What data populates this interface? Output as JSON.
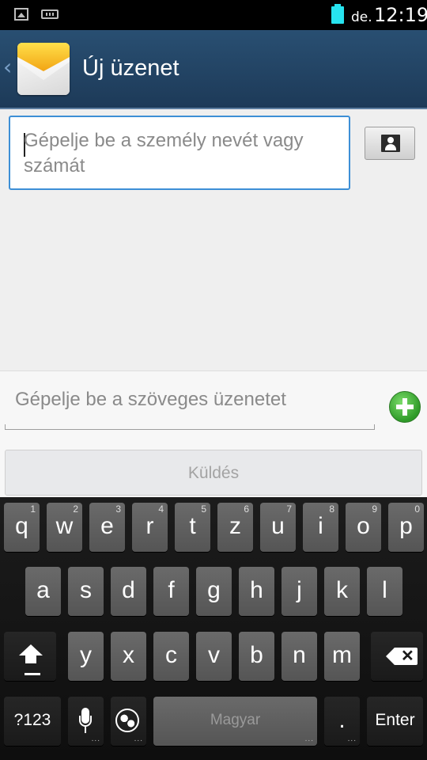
{
  "status_bar": {
    "icons": [
      "gallery-icon",
      "keyboard-icon",
      "battery-icon"
    ],
    "battery_color": "#27e3ef",
    "ampm": "de.",
    "time": "12:19"
  },
  "action_bar": {
    "back_glyph": "‹",
    "app_icon": "envelope-icon",
    "title": "Új üzenet",
    "background": "#244766"
  },
  "recipient": {
    "placeholder": "Gépelje be a személy nevét vagy számát",
    "value": "",
    "accent": "#3d8fd6",
    "contact_icon": "person-icon"
  },
  "compose": {
    "placeholder": "Gépelje be a szöveges üzenetet",
    "value": "",
    "attach_icon": "plus-icon",
    "attach_color": "#3aae30",
    "send_label": "Küldés"
  },
  "keyboard": {
    "row1": [
      {
        "label": "q",
        "sub": "1"
      },
      {
        "label": "w",
        "sub": "2"
      },
      {
        "label": "e",
        "sub": "3"
      },
      {
        "label": "r",
        "sub": "4"
      },
      {
        "label": "t",
        "sub": "5"
      },
      {
        "label": "z",
        "sub": "6"
      },
      {
        "label": "u",
        "sub": "7"
      },
      {
        "label": "i",
        "sub": "8"
      },
      {
        "label": "o",
        "sub": "9"
      },
      {
        "label": "p",
        "sub": "0"
      }
    ],
    "row2": [
      "a",
      "s",
      "d",
      "f",
      "g",
      "h",
      "j",
      "k",
      "l"
    ],
    "row3": [
      "y",
      "x",
      "c",
      "v",
      "b",
      "n",
      "m"
    ],
    "shift_icon": "shift-icon",
    "backspace_icon": "backspace-icon",
    "symbols_label": "?123",
    "mic_icon": "microphone-icon",
    "globe_icon": "globe-icon",
    "space_label": "Magyar",
    "period_label": ".",
    "enter_label": "Enter",
    "more_dots": "..."
  }
}
